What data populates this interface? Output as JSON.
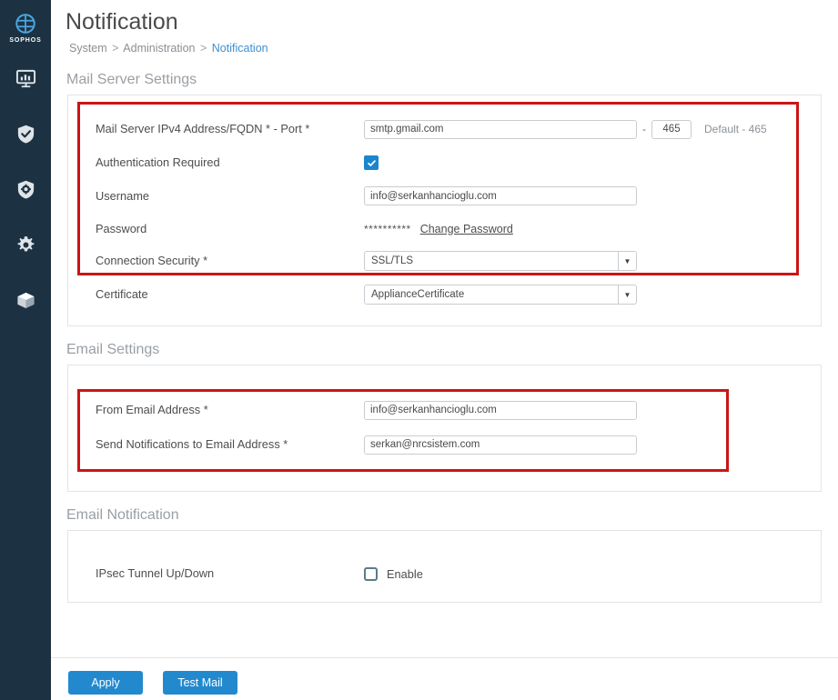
{
  "sidebar": {
    "logo_text": "SOPHOS",
    "items": [
      {
        "icon": "dashboard-monitor-icon",
        "name": "control-center"
      },
      {
        "icon": "shield-check-icon",
        "name": "protect"
      },
      {
        "icon": "shield-gear-icon",
        "name": "configure"
      },
      {
        "icon": "gear-icon",
        "name": "system"
      },
      {
        "icon": "box-icon",
        "name": "objects"
      }
    ]
  },
  "header": {
    "title": "Notification",
    "breadcrumb": {
      "items": [
        "System",
        "Administration",
        "Notification"
      ],
      "separator": ">"
    }
  },
  "sections": {
    "mail_server": {
      "title": "Mail Server Settings",
      "rows": {
        "server_port": {
          "label": "Mail Server IPv4 Address/FQDN *  -  Port *",
          "server_value": "smtp.gmail.com",
          "dash": "-",
          "port_value": "465",
          "hint": "Default - 465"
        },
        "auth": {
          "label": "Authentication Required",
          "checked": true
        },
        "username": {
          "label": "Username",
          "value": "info@serkanhancioglu.com"
        },
        "password": {
          "label": "Password",
          "masked": "**********",
          "change_link": "Change Password"
        },
        "connection_security": {
          "label": "Connection Security *",
          "selected": "SSL/TLS"
        },
        "certificate": {
          "label": "Certificate",
          "selected": "ApplianceCertificate"
        }
      }
    },
    "email_settings": {
      "title": "Email Settings",
      "rows": {
        "from_email": {
          "label": "From Email Address *",
          "value": "info@serkanhancioglu.com"
        },
        "to_email": {
          "label": "Send Notifications to Email Address *",
          "value": "serkan@nrcsistem.com"
        }
      }
    },
    "email_notification": {
      "title": "Email Notification",
      "rows": {
        "ipsec": {
          "label": "IPsec Tunnel Up/Down",
          "checkbox_label": "Enable",
          "checked": false
        }
      }
    }
  },
  "footer": {
    "apply_label": "Apply",
    "test_mail_label": "Test Mail"
  },
  "colors": {
    "sidebar_bg": "#1c3243",
    "accent_blue": "#2389ce",
    "link_blue": "#3d8fd1",
    "annotation_red": "#cc1414",
    "section_title": "#9a9fa4"
  }
}
